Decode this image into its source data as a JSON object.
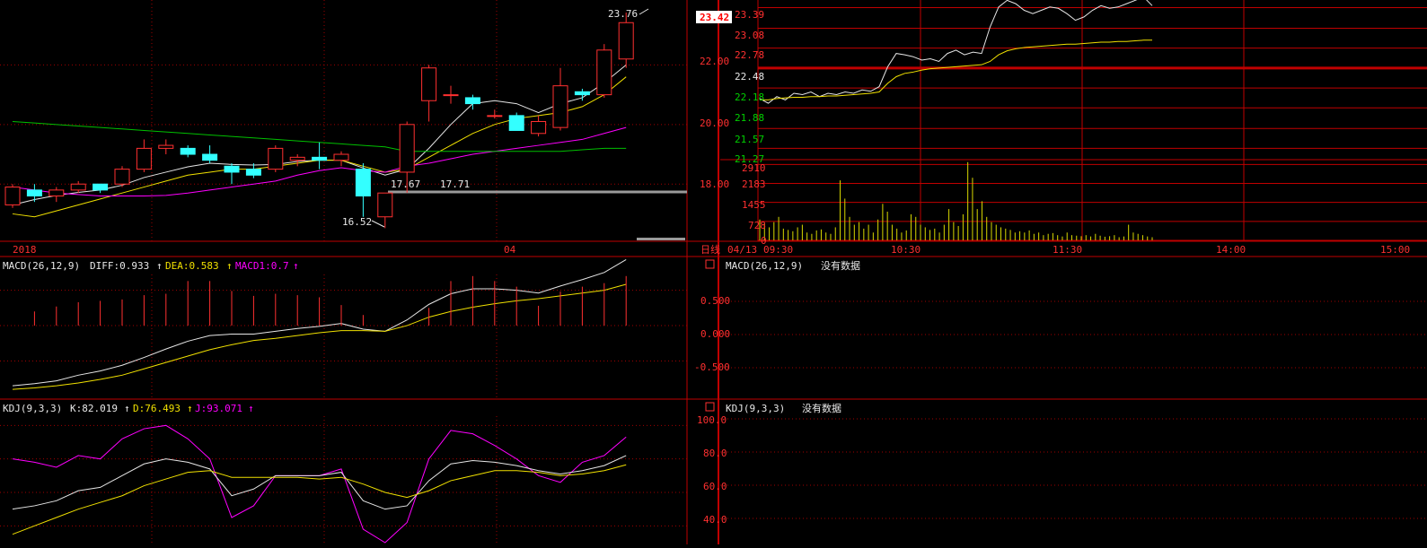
{
  "colors": {
    "background": "#000000",
    "frame": "#c00000",
    "grid": "#a00000",
    "up": "#ff3030",
    "down": "#33ffff",
    "white_line": "#e6e6e6",
    "yellow_line": "#f0e000",
    "magenta_line": "#ff00ff",
    "green_line": "#00c000",
    "axis_text_red": "#ff3030",
    "axis_text_green": "#00d000",
    "volume": "#d8d800",
    "label_text": "#e8e8e8"
  },
  "chart_data": [
    {
      "type": "candlestick",
      "panel": "daily-kline",
      "ylim": [
        16.2,
        24.0
      ],
      "y_ticks": [
        "18.00",
        "20.00",
        "22.00"
      ],
      "x_labels": [
        {
          "label": "2018",
          "index": 0
        },
        {
          "label": "04",
          "index": 22
        }
      ],
      "period_label": "日线",
      "annotations": {
        "high": "23.76",
        "low": "16.52",
        "mid_left": "17.67",
        "mid_right": "17.71"
      },
      "current_price": "23.42",
      "candles": [
        {
          "o": 17.3,
          "h": 18.0,
          "l": 17.2,
          "c": 17.9
        },
        {
          "o": 17.8,
          "h": 18.0,
          "l": 17.4,
          "c": 17.6
        },
        {
          "o": 17.6,
          "h": 17.9,
          "l": 17.4,
          "c": 17.8
        },
        {
          "o": 17.8,
          "h": 18.1,
          "l": 17.7,
          "c": 18.0
        },
        {
          "o": 18.0,
          "h": 18.0,
          "l": 17.7,
          "c": 17.8
        },
        {
          "o": 18.0,
          "h": 18.6,
          "l": 17.9,
          "c": 18.5
        },
        {
          "o": 18.5,
          "h": 19.5,
          "l": 18.4,
          "c": 19.2
        },
        {
          "o": 19.2,
          "h": 19.5,
          "l": 19.0,
          "c": 19.3
        },
        {
          "o": 19.2,
          "h": 19.3,
          "l": 18.9,
          "c": 19.0
        },
        {
          "o": 19.0,
          "h": 19.3,
          "l": 18.7,
          "c": 18.8
        },
        {
          "o": 18.6,
          "h": 18.7,
          "l": 18.0,
          "c": 18.4
        },
        {
          "o": 18.5,
          "h": 18.7,
          "l": 18.2,
          "c": 18.3
        },
        {
          "o": 18.5,
          "h": 19.3,
          "l": 18.4,
          "c": 19.2
        },
        {
          "o": 18.8,
          "h": 19.0,
          "l": 18.6,
          "c": 18.9
        },
        {
          "o": 18.9,
          "h": 19.4,
          "l": 18.5,
          "c": 18.8
        },
        {
          "o": 18.8,
          "h": 19.1,
          "l": 18.6,
          "c": 19.0
        },
        {
          "o": 18.5,
          "h": 18.7,
          "l": 16.9,
          "c": 17.6
        },
        {
          "o": 16.9,
          "h": 17.7,
          "l": 16.52,
          "c": 17.7
        },
        {
          "o": 18.4,
          "h": 20.1,
          "l": 17.71,
          "c": 20.0
        },
        {
          "o": 20.8,
          "h": 22.0,
          "l": 20.1,
          "c": 21.9
        },
        {
          "o": 21.0,
          "h": 21.3,
          "l": 20.7,
          "c": 21.0
        },
        {
          "o": 20.9,
          "h": 21.0,
          "l": 20.5,
          "c": 20.7
        },
        {
          "o": 20.3,
          "h": 20.5,
          "l": 20.2,
          "c": 20.3
        },
        {
          "o": 20.3,
          "h": 20.4,
          "l": 19.8,
          "c": 19.8
        },
        {
          "o": 19.7,
          "h": 20.3,
          "l": 19.6,
          "c": 20.1
        },
        {
          "o": 19.9,
          "h": 21.9,
          "l": 19.8,
          "c": 21.3
        },
        {
          "o": 21.1,
          "h": 21.2,
          "l": 20.8,
          "c": 21.0
        },
        {
          "o": 21.0,
          "h": 22.7,
          "l": 20.9,
          "c": 22.5
        },
        {
          "o": 22.2,
          "h": 23.76,
          "l": 21.9,
          "c": 23.42
        }
      ],
      "series": [
        {
          "color": "white",
          "values": [
            17.3,
            17.48,
            17.62,
            17.72,
            17.8,
            17.96,
            18.22,
            18.4,
            18.58,
            18.7,
            18.66,
            18.64,
            18.66,
            18.76,
            18.8,
            18.8,
            18.54,
            18.3,
            18.5,
            19.2,
            20.0,
            20.7,
            20.8,
            20.7,
            20.4,
            20.7,
            20.9,
            21.4,
            22.0
          ]
        },
        {
          "color": "yellow",
          "values": [
            17.0,
            16.9,
            17.1,
            17.3,
            17.5,
            17.7,
            17.9,
            18.1,
            18.3,
            18.4,
            18.5,
            18.5,
            18.6,
            18.7,
            18.8,
            18.8,
            18.6,
            18.4,
            18.5,
            18.9,
            19.3,
            19.7,
            20.0,
            20.2,
            20.3,
            20.4,
            20.6,
            21.0,
            21.6
          ]
        },
        {
          "color": "magenta",
          "values": [
            17.9,
            17.8,
            17.7,
            17.65,
            17.6,
            17.6,
            17.6,
            17.62,
            17.7,
            17.8,
            17.9,
            18.0,
            18.1,
            18.3,
            18.45,
            18.55,
            18.45,
            18.4,
            18.6,
            18.7,
            18.85,
            19.0,
            19.1,
            19.2,
            19.3,
            19.4,
            19.5,
            19.7,
            19.9
          ]
        },
        {
          "color": "green",
          "values": [
            20.1,
            20.05,
            20.0,
            19.95,
            19.9,
            19.85,
            19.8,
            19.75,
            19.7,
            19.65,
            19.6,
            19.55,
            19.5,
            19.45,
            19.4,
            19.35,
            19.3,
            19.25,
            19.1,
            19.1,
            19.1,
            19.1,
            19.1,
            19.1,
            19.1,
            19.1,
            19.15,
            19.2,
            19.2
          ]
        }
      ]
    },
    {
      "type": "bar+line",
      "panel": "macd-daily",
      "title": "MACD(26,12,9)",
      "readouts": [
        {
          "label": "DIFF:0.933",
          "color": "white"
        },
        {
          "label": "DEA:0.583",
          "color": "yellow"
        },
        {
          "label": "MACD1:0.7",
          "color": "magenta"
        }
      ],
      "ylim": [
        -1.0,
        0.9
      ],
      "y_ticks": [
        "0.500",
        "0.000",
        "-0.500"
      ],
      "y_tick_values": [
        0.5,
        0.0,
        -0.5
      ],
      "histogram": [
        0,
        0.2,
        0.27,
        0.33,
        0.35,
        0.37,
        0.43,
        0.45,
        0.63,
        0.63,
        0.49,
        0.42,
        0.45,
        0.43,
        0.4,
        0.29,
        0.15,
        0,
        0,
        0.25,
        0.63,
        0.7,
        0.63,
        0.55,
        0.28,
        0.48,
        0.55,
        0.6,
        0.7
      ],
      "diff": [
        -0.85,
        -0.82,
        -0.78,
        -0.7,
        -0.64,
        -0.56,
        -0.45,
        -0.33,
        -0.22,
        -0.14,
        -0.12,
        -0.12,
        -0.08,
        -0.04,
        -0.01,
        0.03,
        -0.05,
        -0.08,
        0.08,
        0.3,
        0.45,
        0.52,
        0.52,
        0.5,
        0.46,
        0.56,
        0.65,
        0.75,
        0.933
      ],
      "dea": [
        -0.9,
        -0.88,
        -0.85,
        -0.81,
        -0.76,
        -0.7,
        -0.61,
        -0.52,
        -0.43,
        -0.34,
        -0.27,
        -0.21,
        -0.18,
        -0.14,
        -0.1,
        -0.07,
        -0.07,
        -0.08,
        0.0,
        0.12,
        0.2,
        0.26,
        0.31,
        0.35,
        0.38,
        0.42,
        0.46,
        0.5,
        0.583
      ]
    },
    {
      "type": "line",
      "panel": "kdj-daily",
      "title": "KDJ(9,3,3)",
      "readouts": [
        {
          "label": "K:82.019",
          "color": "white"
        },
        {
          "label": "D:76.493",
          "color": "yellow"
        },
        {
          "label": "J:93.071",
          "color": "magenta"
        }
      ],
      "ylim": [
        30,
        105
      ],
      "y_ticks": [
        "100.0",
        "80.0",
        "60.0",
        "40.0"
      ],
      "y_tick_values": [
        100,
        80,
        60,
        40
      ],
      "k": [
        50,
        52,
        55,
        61,
        63,
        70,
        77,
        80,
        78,
        74,
        58,
        62,
        70,
        70,
        70,
        72,
        55,
        50,
        52,
        67,
        77,
        79,
        78,
        76,
        73,
        71,
        73,
        76,
        82.019
      ],
      "d": [
        35,
        40,
        45,
        50,
        54,
        58,
        64,
        68,
        72,
        73,
        69,
        69,
        69,
        69,
        68,
        69,
        65,
        60,
        57,
        61,
        67,
        70,
        73,
        73,
        72,
        70,
        71,
        73,
        76.493
      ],
      "j": [
        80,
        78,
        75,
        82,
        80,
        92,
        98,
        100,
        92,
        80,
        45,
        52,
        70,
        70,
        70,
        74,
        38,
        30,
        42,
        80,
        97,
        95,
        88,
        80,
        70,
        66,
        78,
        82,
        93.071
      ]
    },
    {
      "type": "line+bar",
      "panel": "intraday",
      "date": "04/13",
      "x_labels": [
        "09:30",
        "10:30",
        "11:30",
        "14:00",
        "15:00"
      ],
      "price_ylim": [
        21.1,
        23.6
      ],
      "price_ticks": [
        {
          "label": "23.39",
          "color": "red"
        },
        {
          "label": "23.08",
          "color": "red"
        },
        {
          "label": "22.78",
          "color": "red"
        },
        {
          "label": "22.48",
          "color": "white"
        },
        {
          "label": "22.18",
          "color": "green"
        },
        {
          "label": "21.88",
          "color": "green"
        },
        {
          "label": "21.57",
          "color": "green"
        },
        {
          "label": "21.27",
          "color": "green"
        }
      ],
      "price_tick_values": [
        23.39,
        23.08,
        22.78,
        22.48,
        22.18,
        21.88,
        21.57,
        21.27
      ],
      "price": [
        22.02,
        21.95,
        22.05,
        22.0,
        22.1,
        22.08,
        22.12,
        22.05,
        22.1,
        22.08,
        22.12,
        22.1,
        22.15,
        22.13,
        22.2,
        22.5,
        22.7,
        22.68,
        22.65,
        22.6,
        22.62,
        22.58,
        22.7,
        22.75,
        22.68,
        22.72,
        22.7,
        23.1,
        23.4,
        23.5,
        23.45,
        23.35,
        23.3,
        23.35,
        23.4,
        23.38,
        23.3,
        23.2,
        23.25,
        23.35,
        23.42,
        23.38,
        23.4,
        23.45,
        23.5,
        23.55,
        23.42
      ],
      "avg": [
        22.0,
        22.0,
        22.02,
        22.03,
        22.04,
        22.04,
        22.05,
        22.05,
        22.06,
        22.06,
        22.07,
        22.08,
        22.09,
        22.1,
        22.12,
        22.25,
        22.35,
        22.4,
        22.42,
        22.45,
        22.47,
        22.48,
        22.49,
        22.5,
        22.51,
        22.52,
        22.53,
        22.58,
        22.68,
        22.74,
        22.77,
        22.79,
        22.8,
        22.81,
        22.82,
        22.83,
        22.84,
        22.84,
        22.85,
        22.86,
        22.87,
        22.87,
        22.88,
        22.88,
        22.89,
        22.9,
        22.9
      ],
      "volume_ylim": [
        0,
        3300
      ],
      "volume_ticks": [
        "2910",
        "2183",
        "1455",
        "728",
        "0"
      ],
      "volume_tick_values": [
        2910,
        2183,
        1455,
        728,
        0
      ],
      "volume": [
        800,
        650,
        500,
        700,
        900,
        450,
        400,
        350,
        500,
        600,
        300,
        250,
        380,
        420,
        300,
        250,
        500,
        2300,
        1600,
        900,
        600,
        700,
        450,
        600,
        300,
        800,
        1400,
        1100,
        600,
        450,
        300,
        380,
        1000,
        900,
        600,
        500,
        400,
        450,
        300,
        600,
        1200,
        700,
        550,
        1000,
        3000,
        2400,
        1200,
        1500,
        900,
        700,
        600,
        500,
        450,
        400,
        300,
        350,
        300,
        380,
        250,
        300,
        200,
        250,
        280,
        200,
        150,
        300,
        200,
        180,
        160,
        200,
        150,
        250,
        180,
        140,
        160,
        200,
        120,
        150,
        600,
        300,
        250,
        200,
        150,
        120
      ]
    },
    {
      "type": "empty",
      "panel": "macd-intraday",
      "title": "MACD(26,12,9)",
      "message": "没有数据"
    },
    {
      "type": "empty",
      "panel": "kdj-intraday",
      "title": "KDJ(9,3,3)",
      "message": "没有数据"
    }
  ]
}
